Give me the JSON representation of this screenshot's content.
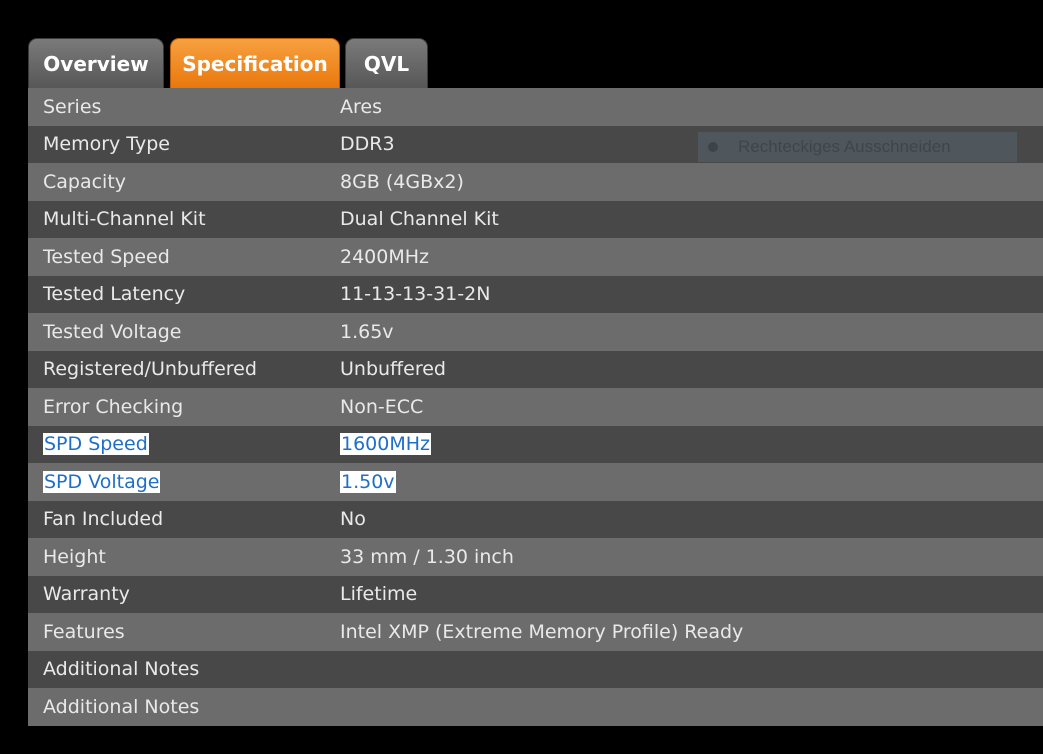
{
  "tabs": {
    "overview": "Overview",
    "specification": "Specification",
    "qvl": "QVL",
    "active": "Specification"
  },
  "rows": [
    {
      "label": "Series",
      "value": "Ares"
    },
    {
      "label": "Memory Type",
      "value": "DDR3"
    },
    {
      "label": "Capacity",
      "value": "8GB (4GBx2)"
    },
    {
      "label": "Multi-Channel Kit",
      "value": "Dual Channel Kit"
    },
    {
      "label": "Tested Speed",
      "value": "2400MHz"
    },
    {
      "label": "Tested Latency",
      "value": "11-13-13-31-2N"
    },
    {
      "label": "Tested Voltage",
      "value": "1.65v"
    },
    {
      "label": "Registered/Unbuffered",
      "value": "Unbuffered"
    },
    {
      "label": "Error Checking",
      "value": "Non-ECC"
    },
    {
      "label": "SPD Speed",
      "value": "1600MHz",
      "highlighted": true
    },
    {
      "label": "SPD Voltage",
      "value": "1.50v",
      "highlighted": true
    },
    {
      "label": "Fan Included",
      "value": "No"
    },
    {
      "label": "Height",
      "value": "33 mm / 1.30 inch"
    },
    {
      "label": "Warranty",
      "value": "Lifetime"
    },
    {
      "label": "Features",
      "value": "Intel XMP (Extreme Memory Profile) Ready"
    },
    {
      "label": "Additional Notes",
      "value": ""
    },
    {
      "label": "Additional Notes",
      "value": ""
    }
  ],
  "overlay": {
    "text": "Rechteckiges Ausschneiden"
  },
  "colors": {
    "active_tab": "#e9780c",
    "row_light": "#6c6c6c",
    "row_dark": "#484848",
    "highlight_text": "#1f6fc6"
  }
}
